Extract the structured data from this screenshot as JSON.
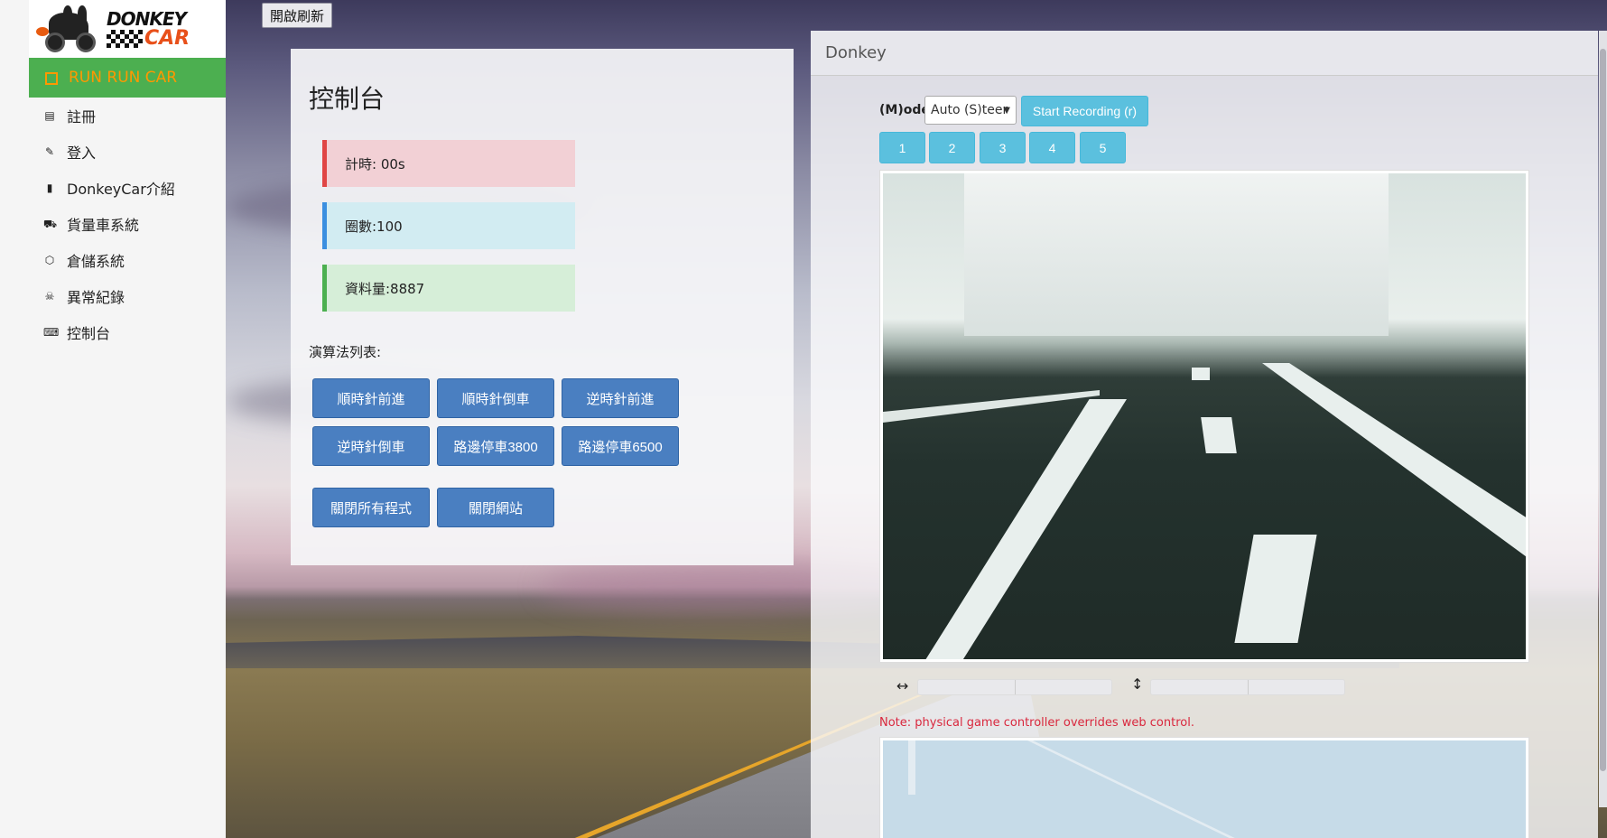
{
  "sidebar": {
    "logo_top": "DONKEY",
    "logo_bottom": "CAR",
    "home_label": "RUN RUN CAR",
    "items": [
      {
        "label": "註冊",
        "icon": "register-table-icon",
        "glyph": "▤"
      },
      {
        "label": "登入",
        "icon": "login-key-icon",
        "glyph": "✎"
      },
      {
        "label": "DonkeyCar介紹",
        "icon": "document-icon",
        "glyph": "▮"
      },
      {
        "label": "貨量車系統",
        "icon": "truck-icon",
        "glyph": "⛟"
      },
      {
        "label": "倉儲系統",
        "icon": "box-icon",
        "glyph": "⬡"
      },
      {
        "label": "異常紀錄",
        "icon": "skull-icon",
        "glyph": "☠"
      },
      {
        "label": "控制台",
        "icon": "gamepad-icon",
        "glyph": "⌨"
      }
    ]
  },
  "toolbar": {
    "refresh_label": "開啟刷新"
  },
  "console": {
    "title": "控制台",
    "timer": "計時: 00s",
    "laps": "圈數:100",
    "data_count": "資料量:8887",
    "algo_label": "演算法列表:",
    "algo_buttons": [
      "順時針前進",
      "順時針倒車",
      "逆時針前進",
      "逆時針倒車",
      "路邊停車3800",
      "路邊停車6500"
    ],
    "close_all": "關閉所有程式",
    "close_site": "關閉網站"
  },
  "donkey": {
    "title": "Donkey",
    "mode_label": "(M)ode",
    "mode_value": "Auto (S)teer",
    "record_label": "Start Recording (r)",
    "num_buttons": [
      "1",
      "2",
      "3",
      "4",
      "5"
    ],
    "steer_arrow": "↔",
    "throttle_arrow": "↕",
    "note": "Note: physical game controller overrides web control."
  },
  "colors": {
    "home_bg": "#4caf50",
    "home_text": "#ff9800",
    "algo_button": "#4a7fc1",
    "info_button": "#5bc0de",
    "note": "#d9273d"
  }
}
